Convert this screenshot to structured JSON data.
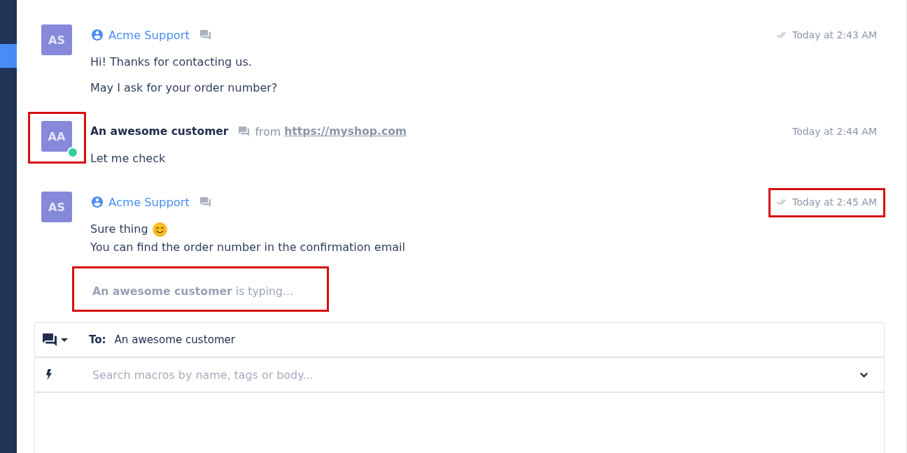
{
  "sidebar": {
    "items": [
      {
        "selected": false
      },
      {
        "selected": true
      }
    ]
  },
  "messages": [
    {
      "kind": "agent",
      "initials": "AS",
      "author": "Acme Support",
      "time": "Today at 2:43 AM",
      "read": true,
      "online": false,
      "avatar_highlighted": false,
      "time_highlighted": false,
      "paragraphs": [
        [
          {
            "text": "Hi! Thanks for contacting us."
          }
        ],
        [
          {
            "text": "May I ask for your order number?"
          }
        ]
      ]
    },
    {
      "kind": "customer",
      "initials": "AA",
      "author": "An awesome customer",
      "source_prefix": "from",
      "source_url": "https://myshop.com",
      "time": "Today at 2:44 AM",
      "read": false,
      "online": true,
      "avatar_highlighted": true,
      "time_highlighted": false,
      "paragraphs": [
        [
          {
            "text": "Let me check"
          }
        ]
      ]
    },
    {
      "kind": "agent",
      "initials": "AS",
      "author": "Acme Support",
      "time": "Today at 2:45 AM",
      "read": true,
      "online": false,
      "avatar_highlighted": false,
      "time_highlighted": true,
      "paragraphs": [
        [
          {
            "text": "Sure thing",
            "emoji": true
          },
          {
            "text": "You can find the order number in the confirmation email"
          }
        ]
      ]
    }
  ],
  "typing": {
    "text": "**An awesome customer** is typing...",
    "highlighted": true
  },
  "composer": {
    "to_label": "To:",
    "recipient": "An awesome customer",
    "macro_search": {
      "placeholder": "Search macros by name, tags or body..."
    }
  }
}
